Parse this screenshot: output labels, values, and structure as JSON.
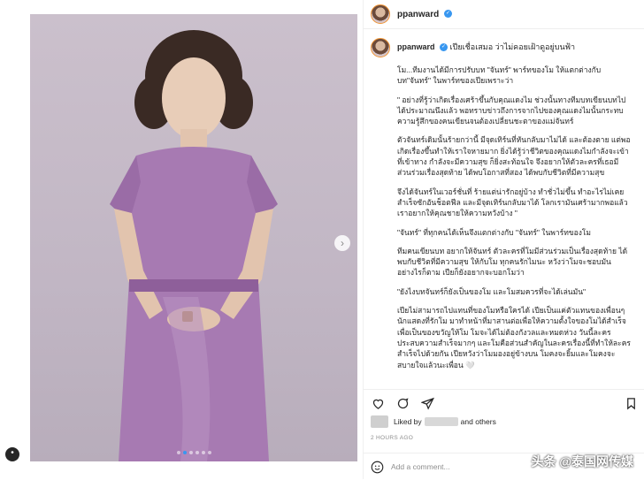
{
  "post": {
    "username": "ppanward",
    "caption_head": "เปียเชื่อเสมอ ว่าไม่คอยเฝ้าดูอยู่บนฟ้า",
    "caption_paragraphs": [
      "โม...ทีมงานได้มีการปรับบท \"จันทร์\" พาร์ทของโม ให้แตกต่างกับบท\"จันทร์\" ในพาร์ทของเปียเพราะว่า",
      "\" อย่างที่รู้ว่าเกิดเรื่องเศร้าขึ้นกับคุณแดงไม ช่วงนั้นทางทีมบทเขียนบทไปได้ประมาณนึงแล้ว พอทราบข่าวถึงการจากไปของคุณแดงไมนั้นกระทบความรู้สึกของคนเขียนจนต้องเปลี่ยนชะตาของแม่จันทร์",
      "ตัวจันทร์เดิมนั้นร้ายกว่านี้ มีจุดเทิร์นที่หันกลับมาไม่ได้ และต้องตาย แต่พอเกิดเรื่องขึ้นทำให้เราใจหายมาก ยิ่งได้รู้ว่าชีวิตของคุณแดงไมกำลังจะเข้าที่เข้าทาง กำลังจะมีความสุข ก็ยิ่งสะท้อนใจ จึงอยากให้ตัวละครที่เธอมีส่วนร่วมเรื่องสุดท้าย ได้พบโอกาสที่สอง ได้พบกับชีวิตที่มีความสุข",
      "จึงได้จันทร์ในเวอร์ชั่นที่ ร้ายแต่น่ารักอยู่บ้าง ทำชั่วไม่ขึ้น ทำอะไรไม่เคยสำเร็จซักอันช็อตฟีล และมีจุดเทิร์นกลับมาได้ โลกเรามันเศร้ามากพอแล้ว เราอยากให้คุณชายให้ความหวังบ้าง \"",
      "\"จันทร์\" ที่ทุกคนได้เห็นจึงแตกต่างกับ \"จันทร์\" ในพาร์ทของโม",
      "ทีมคนเขียนบท อยากให้จันทร์ ตัวละครที่โมมีส่วนร่วมเป็นเรื่องสุดท้าย ได้พบกับชีวิตที่มีความสุข ให้กับโม ทุกคนรักไมนะ หวังว่าโมจะชอบมันอย่างไรก็ตาม เปียก็ยังอยากจะบอกโมว่า",
      "\"ยังไงบทจันทร์ก็ยังเป็นของโม และโมสมควรที่จะได้เล่นมัน\"",
      "เปียไม่สามารถไปแทนที่ของโมหรือใครได้ เปียเป็นแค่ตัวแทนของเพื่อนๆนักแสดงที่รักโม มาทำหน้าที่มาสานต่อเพื่อให้ความตั้งใจของโมได้สำเร็จ เพื่อเป็นของขวัญให้โม โมจะได้ไม่ต้องกังวลและหมดห่วง วันนี้ละครประสบความสำเร็จมากๆ และโมคือส่วนสำคัญในละครเรื่องนี้ที่ทำให้ละครสำเร็จไปด้วยกัน เปียหวังว่าโมมองอยู่ข้างบน โมคงจะยิ้มและโมคงจะสบายใจแล้วนะเพื่อน 🤍"
    ],
    "likes_prefix": "Liked by",
    "likes_suffix": "and others",
    "timestamp": "2 HOURS AGO",
    "comment_placeholder": "Add a comment...",
    "watermark": "头条 @泰国网传媒"
  },
  "icons": {
    "like": "heart-icon",
    "comment": "comment-icon",
    "share": "share-icon",
    "save": "bookmark-icon",
    "emoji": "smiley-icon",
    "verified": "verified-badge-icon",
    "next": "chevron-right-icon",
    "more": "more-icon"
  },
  "colors": {
    "accent": "#3897f0",
    "border": "#efefef",
    "muted": "#8e8e8e"
  }
}
